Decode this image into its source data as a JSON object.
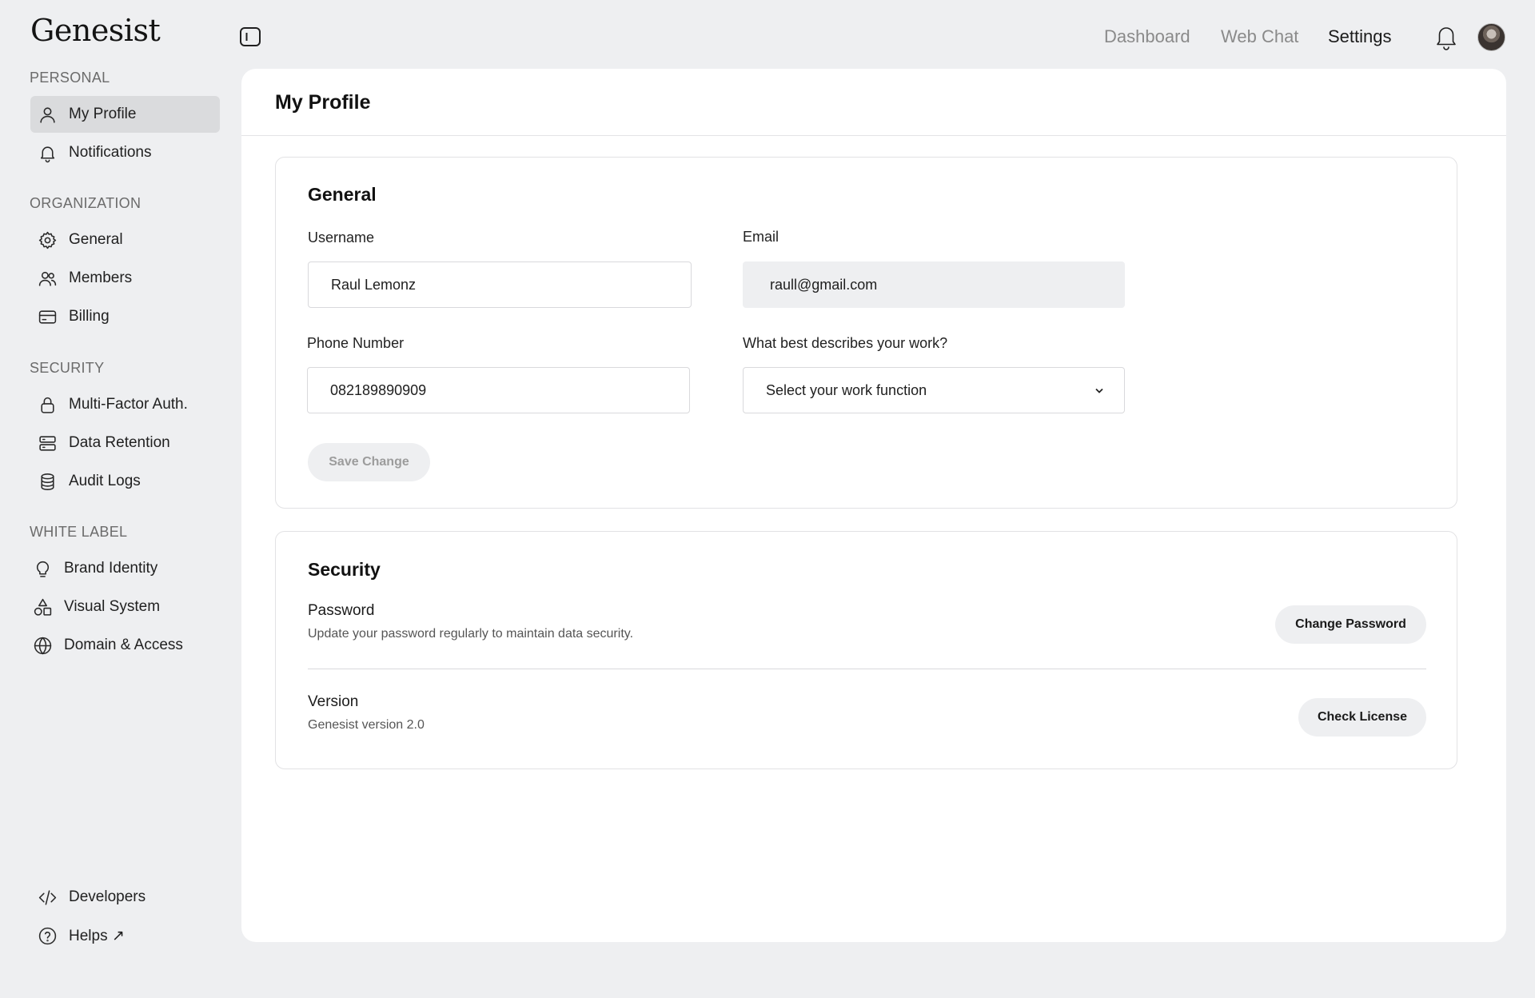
{
  "app": {
    "logo": "Genesist"
  },
  "sidebar": {
    "sections": [
      {
        "label": "PERSONAL"
      },
      {
        "label": "ORGANIZATION"
      },
      {
        "label": "SECURITY"
      },
      {
        "label": "WHITE LABEL"
      }
    ],
    "items": [
      {
        "label": "My Profile",
        "icon": "user-icon",
        "active": true
      },
      {
        "label": "Notifications",
        "icon": "bell-icon"
      },
      {
        "label": "General",
        "icon": "gear-icon"
      },
      {
        "label": "Members",
        "icon": "users-icon"
      },
      {
        "label": "Billing",
        "icon": "credit-card-icon"
      },
      {
        "label": "Multi-Factor Auth.",
        "icon": "lock-icon"
      },
      {
        "label": "Data Retention",
        "icon": "server-icon"
      },
      {
        "label": "Audit Logs",
        "icon": "database-icon"
      },
      {
        "label": "Brand Identity",
        "icon": "lightbulb-icon"
      },
      {
        "label": "Visual System",
        "icon": "shapes-icon"
      },
      {
        "label": "Domain & Access",
        "icon": "globe-icon"
      }
    ],
    "footer": [
      {
        "label": "Developers",
        "icon": "code-icon"
      },
      {
        "label": "Helps ↗",
        "icon": "help-circle-icon"
      }
    ]
  },
  "topbar": {
    "nav": [
      "Dashboard",
      "Web Chat",
      "Settings"
    ],
    "active": "Settings"
  },
  "page": {
    "title": "My Profile",
    "general": {
      "title": "General",
      "username_label": "Username",
      "username_value": "Raul Lemonz",
      "email_label": "Email",
      "email_value": "raull@gmail.com",
      "phone_label": "Phone Number",
      "phone_value": "082189890909",
      "work_label": "What best describes your work?",
      "work_placeholder": "Select your work function",
      "save_label": "Save Change"
    },
    "security": {
      "title": "Security",
      "password_title": "Password",
      "password_desc": "Update your password regularly to maintain data security.",
      "change_password_label": "Change Password",
      "version_title": "Version",
      "version_desc": "Genesist version 2.0",
      "check_license_label": "Check License"
    }
  },
  "colors": {
    "background": "#eeeff1",
    "card": "#ffffff",
    "active_nav": "#dadbdd",
    "muted_text": "#8a8a8a"
  }
}
